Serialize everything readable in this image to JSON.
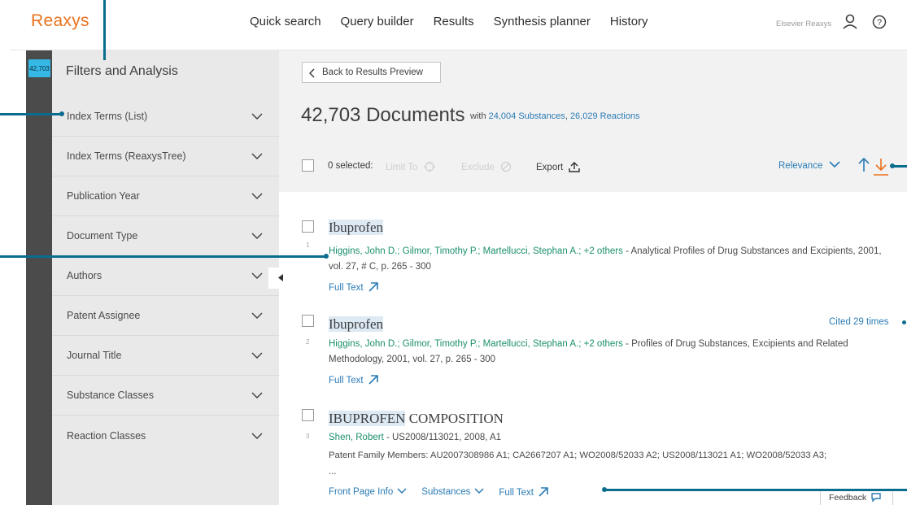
{
  "topbar": {
    "logo": "Reaxys",
    "nav": [
      "Quick search",
      "Query builder",
      "Results",
      "Synthesis planner",
      "History"
    ],
    "account_text": "Elsevier Reaxys"
  },
  "rail": {
    "badge": "42,703"
  },
  "filters": {
    "title": "Filters and Analysis",
    "items": [
      "Index Terms (List)",
      "Index Terms (ReaxysTree)",
      "Publication Year",
      "Document Type",
      "Authors",
      "Patent Assignee",
      "Journal Title",
      "Substance Classes",
      "Reaction Classes"
    ]
  },
  "header": {
    "back_label": "Back to Results Preview",
    "count": "42,703 Documents",
    "with_prefix": "with ",
    "substances_link": "24,004 Substances",
    "separator": ", ",
    "reactions_link": "26,029 Reactions"
  },
  "toolbar": {
    "selected": "0 selected:",
    "limit_to": "Limit To",
    "exclude": "Exclude",
    "export": "Export",
    "sort": "Relevance"
  },
  "results": [
    {
      "num": "1",
      "title": "Ibuprofen",
      "authors": "Higgins, John D.; Gilmor, Timothy P.; Martellucci, Stephan A.; +2 others",
      "source": " - Analytical Profiles of Drug Substances and Excipients, 2001, vol. 27, # C, p. 265 - 300",
      "full_text": "Full Text"
    },
    {
      "num": "2",
      "title": "Ibuprofen",
      "authors": "Higgins, John D.; Gilmor, Timothy P.; Martellucci, Stephan A.; +2 others",
      "source": " - Profiles of Drug Substances, Excipients and Related Methodology, 2001, vol. 27, p. 265 - 300",
      "full_text": "Full Text",
      "cited": "Cited 29 times"
    },
    {
      "num": "3",
      "title_hl": "IBUPROFEN",
      "title_rest": " COMPOSITION",
      "authors": "Shen, Robert",
      "source": " - US2008/113021, 2008, A1",
      "family": "Patent Family Members: AU2007308986 A1; CA2667207 A1; WO2008/52033 A2; US2008/113021 A1; WO2008/52033 A3;",
      "ellipsis": "...",
      "links": [
        "Front Page Info",
        "Substances",
        "Full Text"
      ]
    }
  ],
  "feedback": "Feedback",
  "colors": {
    "brand": "#e9711c",
    "link": "#2a7bb5",
    "author": "#1a8f6c",
    "badge": "#35b8e6",
    "annotation": "#0b6d8e"
  }
}
